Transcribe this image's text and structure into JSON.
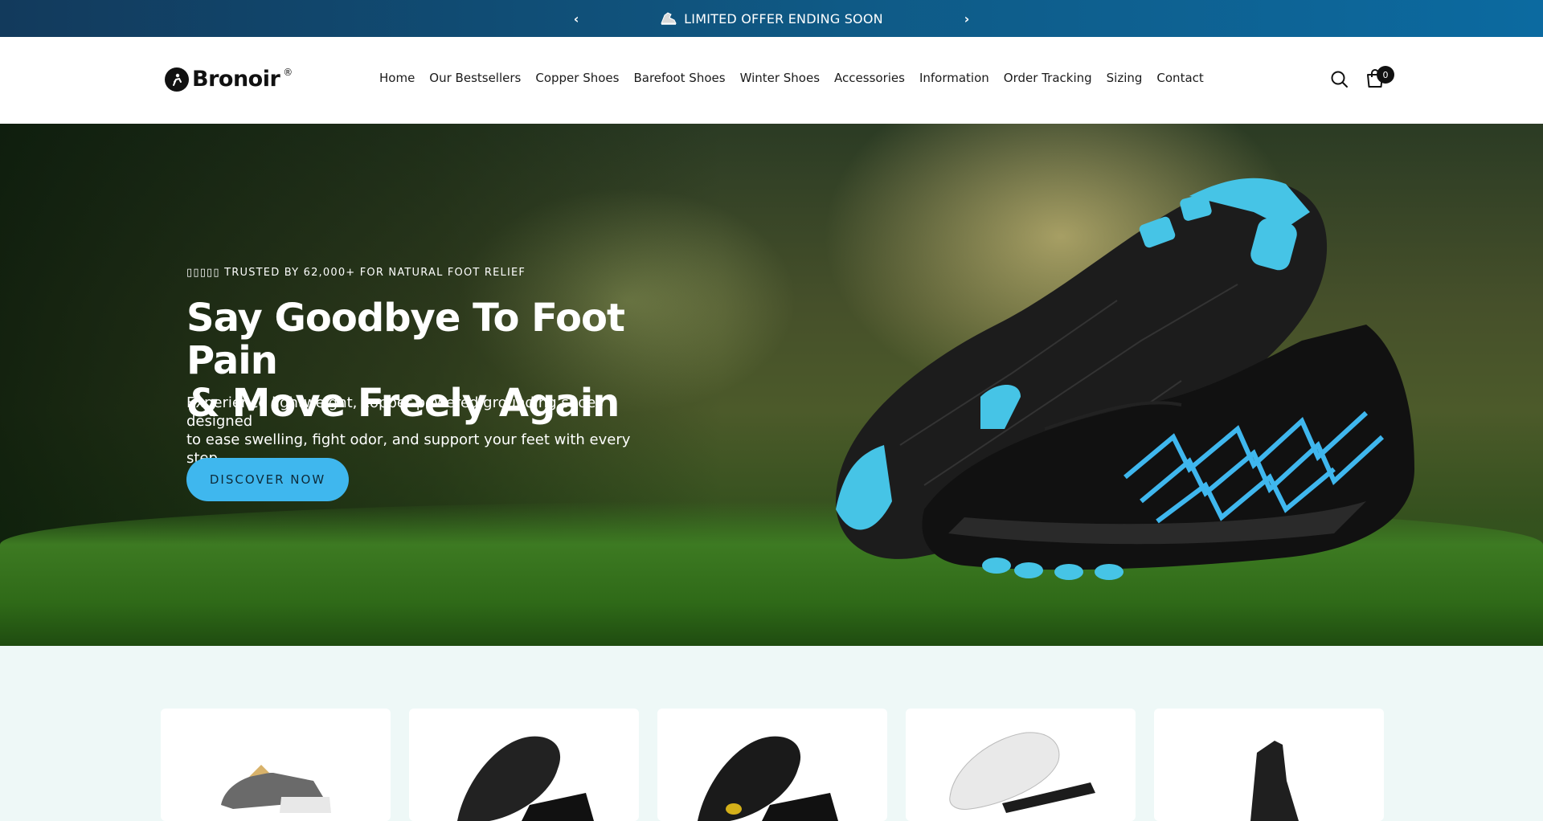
{
  "announcement": {
    "text": "LIMITED OFFER ENDING SOON",
    "prev_icon": "chevron-left-icon",
    "next_icon": "chevron-right-icon",
    "shoe_icon": "running-shoe-icon"
  },
  "header": {
    "logo_text": "Bronoir",
    "logo_reg": "®",
    "nav": [
      "Home",
      "Our Bestsellers",
      "Copper Shoes",
      "Barefoot Shoes",
      "Winter Shoes",
      "Accessories",
      "Information",
      "Order Tracking",
      "Sizing",
      "Contact"
    ],
    "cart_count": "0"
  },
  "hero": {
    "eyebrow": "▯▯▯▯▯ TRUSTED BY 62,000+ FOR NATURAL FOOT RELIEF",
    "heading_line1": "Say Goodbye To Foot Pain",
    "heading_line2": "& Move Freely Again",
    "subtext_line1": "Experience lightweight, copper-powered grounding shoes designed",
    "subtext_line2": "to ease swelling, fight odor, and support your feet with every step.",
    "cta": "DISCOVER NOW"
  },
  "products": [
    "gray-barefoot-shoe",
    "black-barefoot-shoe",
    "black-yellow-barefoot-shoe",
    "white-insole",
    "black-winter-boot"
  ],
  "colors": {
    "accent": "#3fb7ee",
    "announcement_bg": "#0f5a86",
    "page_bg": "#eef8f7"
  }
}
